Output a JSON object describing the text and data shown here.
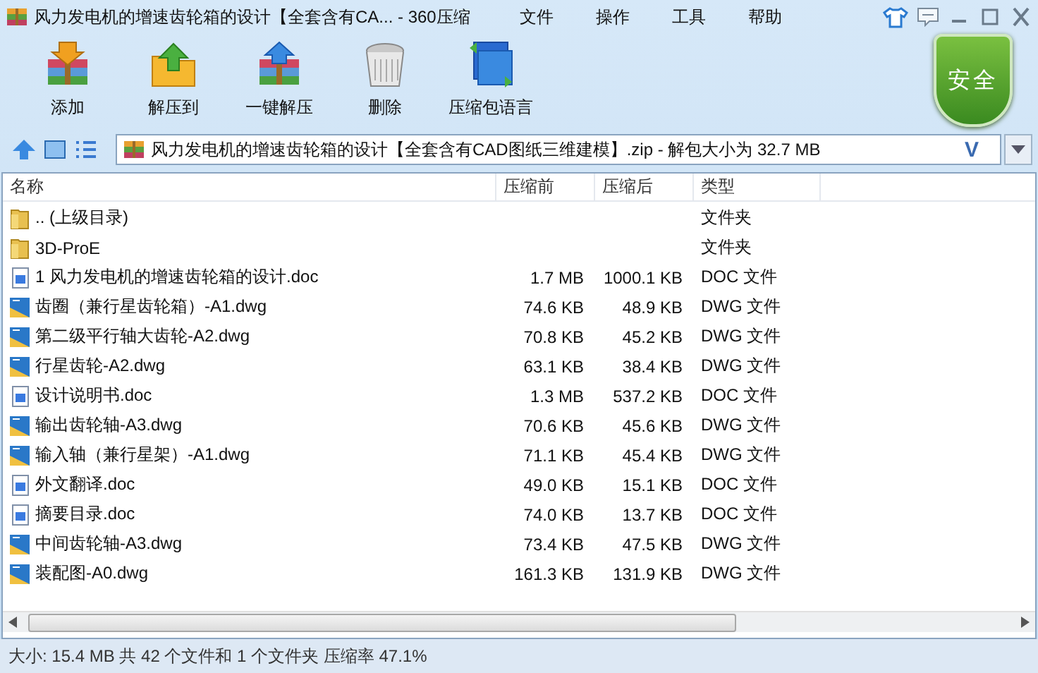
{
  "window": {
    "title": "风力发电机的增速齿轮箱的设计【全套含有CA... - 360压缩",
    "menu": [
      "文件",
      "操作",
      "工具",
      "帮助"
    ]
  },
  "toolbar": [
    "添加",
    "解压到",
    "一键解压",
    "删除",
    "压缩包语言"
  ],
  "security_badge": "安全",
  "address": {
    "value": "风力发电机的增速齿轮箱的设计【全套含有CAD图纸三维建模】.zip - 解包大小为 32.7 MB",
    "v_label": "V"
  },
  "table": {
    "columns": [
      "名称",
      "压缩前",
      "压缩后",
      "类型"
    ],
    "rows": [
      {
        "kind": "folder",
        "name": ".. (上级目录)",
        "size": "",
        "packed": "",
        "type": "文件夹"
      },
      {
        "kind": "folder",
        "name": "3D-ProE",
        "size": "",
        "packed": "",
        "type": "文件夹"
      },
      {
        "kind": "doc",
        "name": "1 风力发电机的增速齿轮箱的设计.doc",
        "size": "1.7 MB",
        "packed": "1000.1 KB",
        "type": "DOC 文件"
      },
      {
        "kind": "dwg",
        "name": "齿圈（兼行星齿轮箱）-A1.dwg",
        "size": "74.6 KB",
        "packed": "48.9 KB",
        "type": "DWG 文件"
      },
      {
        "kind": "dwg",
        "name": "第二级平行轴大齿轮-A2.dwg",
        "size": "70.8 KB",
        "packed": "45.2 KB",
        "type": "DWG 文件"
      },
      {
        "kind": "dwg",
        "name": "行星齿轮-A2.dwg",
        "size": "63.1 KB",
        "packed": "38.4 KB",
        "type": "DWG 文件"
      },
      {
        "kind": "doc",
        "name": "设计说明书.doc",
        "size": "1.3 MB",
        "packed": "537.2 KB",
        "type": "DOC 文件"
      },
      {
        "kind": "dwg",
        "name": "输出齿轮轴-A3.dwg",
        "size": "70.6 KB",
        "packed": "45.6 KB",
        "type": "DWG 文件"
      },
      {
        "kind": "dwg",
        "name": "输入轴（兼行星架）-A1.dwg",
        "size": "71.1 KB",
        "packed": "45.4 KB",
        "type": "DWG 文件"
      },
      {
        "kind": "doc",
        "name": "外文翻译.doc",
        "size": "49.0 KB",
        "packed": "15.1 KB",
        "type": "DOC 文件"
      },
      {
        "kind": "doc",
        "name": "摘要目录.doc",
        "size": "74.0 KB",
        "packed": "13.7 KB",
        "type": "DOC 文件"
      },
      {
        "kind": "dwg",
        "name": "中间齿轮轴-A3.dwg",
        "size": "73.4 KB",
        "packed": "47.5 KB",
        "type": "DWG 文件"
      },
      {
        "kind": "dwg",
        "name": "装配图-A0.dwg",
        "size": "161.3 KB",
        "packed": "131.9 KB",
        "type": "DWG 文件"
      }
    ]
  },
  "status_bar": "大小: 15.4 MB 共 42 个文件和 1 个文件夹 压缩率 47.1%"
}
